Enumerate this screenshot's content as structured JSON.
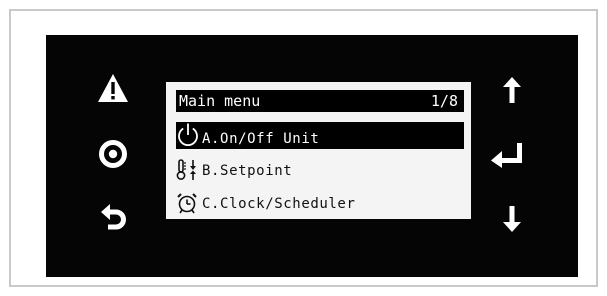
{
  "screen": {
    "title": "Main menu",
    "page_indicator": "1/8"
  },
  "menu": {
    "items": [
      {
        "label": "A.On/Off Unit",
        "icon": "power-icon",
        "selected": true
      },
      {
        "label": "B.Setpoint",
        "icon": "thermometer-setpoint-icon",
        "selected": false
      },
      {
        "label": "C.Clock/Scheduler",
        "icon": "alarm-clock-icon",
        "selected": false
      }
    ]
  },
  "buttons": {
    "left": [
      "alarm-warning-icon",
      "program-circle-icon",
      "escape-back-icon"
    ],
    "right": [
      "arrow-up-icon",
      "enter-icon",
      "arrow-down-icon"
    ]
  },
  "colors": {
    "panel": "#050505",
    "lcd_background": "#f4f4f4",
    "frame_border": "#c9c9c9"
  }
}
